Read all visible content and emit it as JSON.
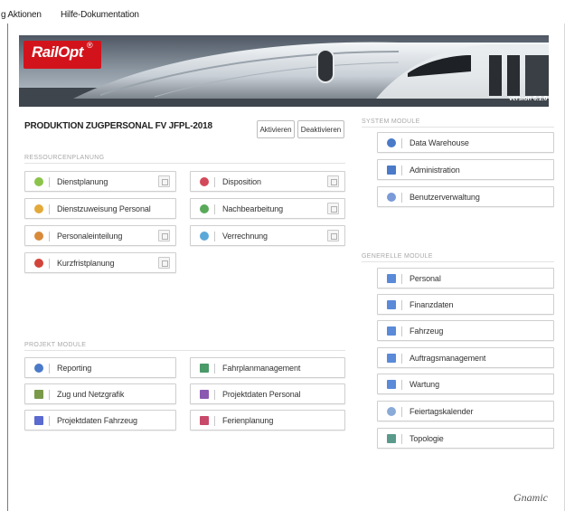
{
  "menubar": {
    "aktionen": "g Aktionen",
    "hilfe": "Hilfe-Dokumentation"
  },
  "banner": {
    "logo": "RailOpt",
    "logo_mark": "®",
    "version": "version 6.1.0"
  },
  "production": {
    "title": "PRODUKTION ZUGPERSONAL FV JFPL-2018",
    "activate": "Aktivieren",
    "deactivate": "Deaktivieren"
  },
  "sections": {
    "ressourcen": "RESSOURCENPLANUNG",
    "projekt": "PROJEKT MODULE",
    "system": "SYSTEM MODULE",
    "generell": "GENERELLE MODULE"
  },
  "ressourcen_modules": [
    {
      "label": "Dienstplanung",
      "icon": "dienstplan-icon",
      "color": "#8cc34a"
    },
    {
      "label": "Disposition",
      "icon": "disposition-icon",
      "color": "#d24a5a"
    },
    {
      "label": "Dienstzuweisung Personal",
      "icon": "zuweisung-icon",
      "color": "#e3a93a"
    },
    {
      "label": "Nachbearbeitung",
      "icon": "nachbearbeitung-icon",
      "color": "#5aa85a"
    },
    {
      "label": "Personaleinteilung",
      "icon": "personaleinteilung-icon",
      "color": "#d88a3a"
    },
    {
      "label": "Verrechnung",
      "icon": "verrechnung-icon",
      "color": "#5aa8d8"
    },
    {
      "label": "Kurzfristplanung",
      "icon": "kurzfrist-icon",
      "color": "#d2443a"
    }
  ],
  "projekt_modules": [
    {
      "label": "Reporting",
      "icon": "reporting-icon",
      "color": "#4a7ac8"
    },
    {
      "label": "Fahrplanmanagement",
      "icon": "fahrplan-icon",
      "color": "#4a9a6a"
    },
    {
      "label": "Zug und Netzgrafik",
      "icon": "netzgrafik-icon",
      "color": "#7a9a4a"
    },
    {
      "label": "Projektdaten Personal",
      "icon": "projektdaten-personal-icon",
      "color": "#8a5ab0"
    },
    {
      "label": "Projektdaten Fahrzeug",
      "icon": "projektdaten-fahrzeug-icon",
      "color": "#5a6ad0"
    },
    {
      "label": "Ferienplanung",
      "icon": "ferienplanung-icon",
      "color": "#c84a6a"
    }
  ],
  "system_modules": [
    {
      "label": "Data Warehouse",
      "icon": "data-warehouse-icon",
      "color": "#4a7ac8"
    },
    {
      "label": "Administration",
      "icon": "administration-icon",
      "color": "#4a7ac8"
    },
    {
      "label": "Benutzerverwaltung",
      "icon": "benutzer-icon",
      "color": "#7a9ad8"
    }
  ],
  "generell_modules": [
    {
      "label": "Personal",
      "icon": "personal-icon",
      "color": "#5a8ad8"
    },
    {
      "label": "Finanzdaten",
      "icon": "finanzdaten-icon",
      "color": "#5a8ad8"
    },
    {
      "label": "Fahrzeug",
      "icon": "fahrzeug-icon",
      "color": "#5a8ad8"
    },
    {
      "label": "Auftragsmanagement",
      "icon": "auftrag-icon",
      "color": "#5a8ad8"
    },
    {
      "label": "Wartung",
      "icon": "wartung-icon",
      "color": "#5a8ad8"
    },
    {
      "label": "Feiertagskalender",
      "icon": "feiertag-icon",
      "color": "#8aaad8"
    },
    {
      "label": "Topologie",
      "icon": "topologie-icon",
      "color": "#5a9a8a"
    }
  ],
  "footer": {
    "brand": "Gnamic"
  }
}
